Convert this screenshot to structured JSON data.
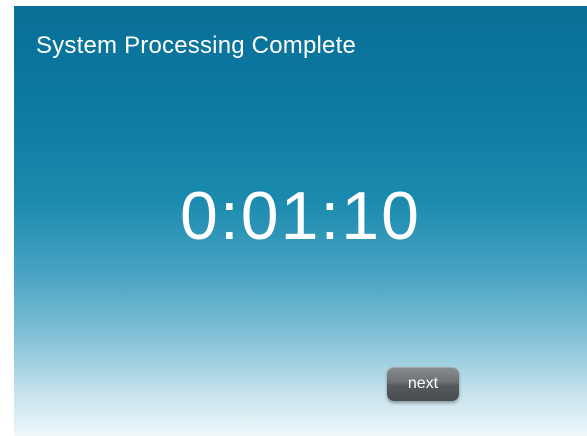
{
  "screen": {
    "title": "System Processing Complete",
    "timer": "0:01:10",
    "next_label": "next"
  },
  "colors": {
    "background_top": "#0a6f97",
    "background_bottom": "#eef7fa",
    "text": "#ffffff",
    "button": "#5e6164"
  }
}
